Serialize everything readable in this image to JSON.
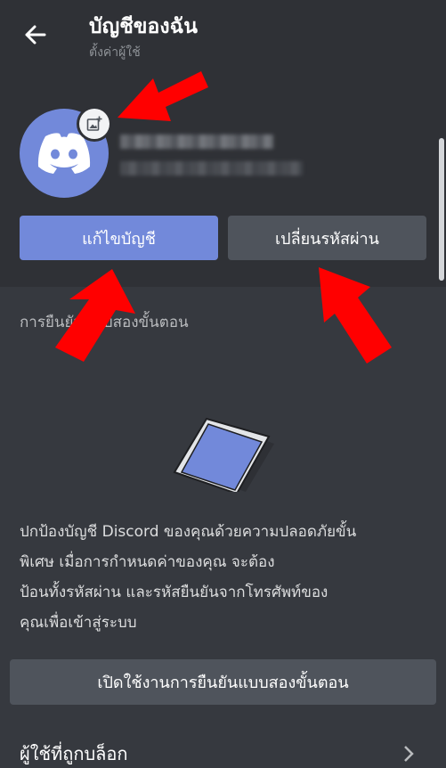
{
  "header": {
    "title": "บัญชีของฉัน",
    "subtitle": "ตั้งค่าผู้ใช้"
  },
  "icons": {
    "back": "back-arrow-icon",
    "avatar": "discord-logo-icon",
    "avatar_badge": "add-image-icon",
    "phone": "phone-illustration-icon",
    "chevron": "chevron-right-icon",
    "annotation": "red-arrow-annotation"
  },
  "profile": {
    "username": "",
    "email": ""
  },
  "buttons": {
    "edit_account": "แก้ไขบัญชี",
    "change_password": "เปลี่ยนรหัสผ่าน",
    "enable_2fa": "เปิดใช้งานการยืนยันแบบสองขั้นตอน"
  },
  "two_factor": {
    "section_label": "การยืนยันแบบสองขั้นตอน",
    "description_lines": [
      "ปกป้องบัญชี Discord ของคุณด้วยความปลอดภัยขั้น",
      "พิเศษ เมื่อการกำหนดค่าของคุณ จะต้อง",
      "ป้อนทั้งรหัสผ่าน และรหัสยืนยันจากโทรศัพท์ของ",
      "คุณเพื่อเข้าสู่ระบบ"
    ]
  },
  "blocked_users": {
    "label": "ผู้ใช้ที่ถูกบล็อก"
  },
  "colors": {
    "background": "#36393f",
    "header_bg": "#2f3136",
    "blurple": "#7289da",
    "secondary_button": "#4f545c",
    "annotation_red": "#ff0000"
  }
}
